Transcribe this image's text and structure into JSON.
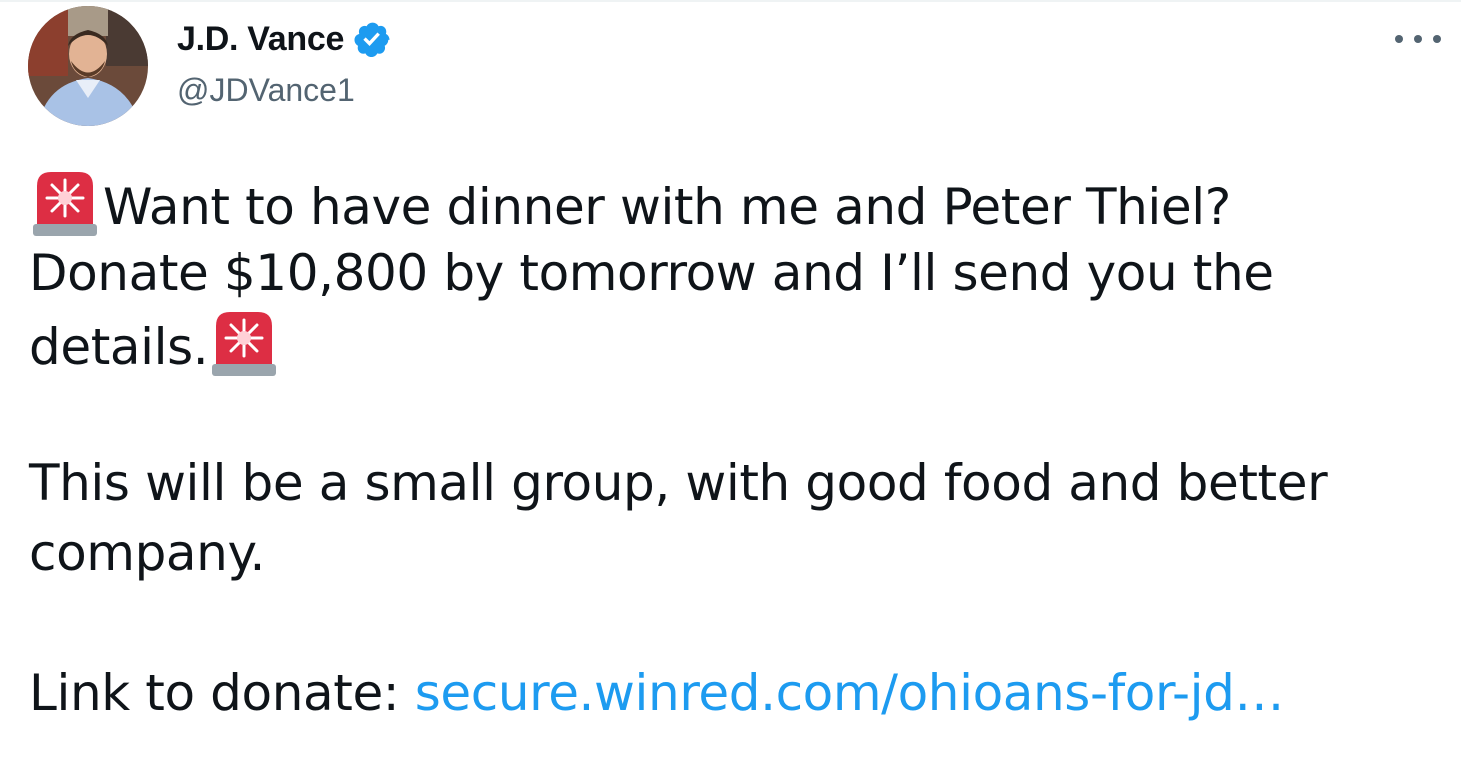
{
  "author": {
    "display_name": "J.D. Vance",
    "handle": "@JDVance1",
    "verified": true,
    "verified_color": "#1d9bf0"
  },
  "more_icon": "more-horizontal-icon",
  "tweet": {
    "emoji": "police-car-light",
    "line1": "Want to have dinner with me and Peter Thiel?",
    "line2": "Donate $10,800 by tomorrow and I’ll send you the",
    "line3": "details.",
    "line4": "This will be a small group, with good food and better",
    "line5": "company.",
    "link_prefix": "Link to donate: ",
    "link_text": "secure.winred.com/ohioans-for-jd…",
    "link_color": "#1d9bf0"
  }
}
